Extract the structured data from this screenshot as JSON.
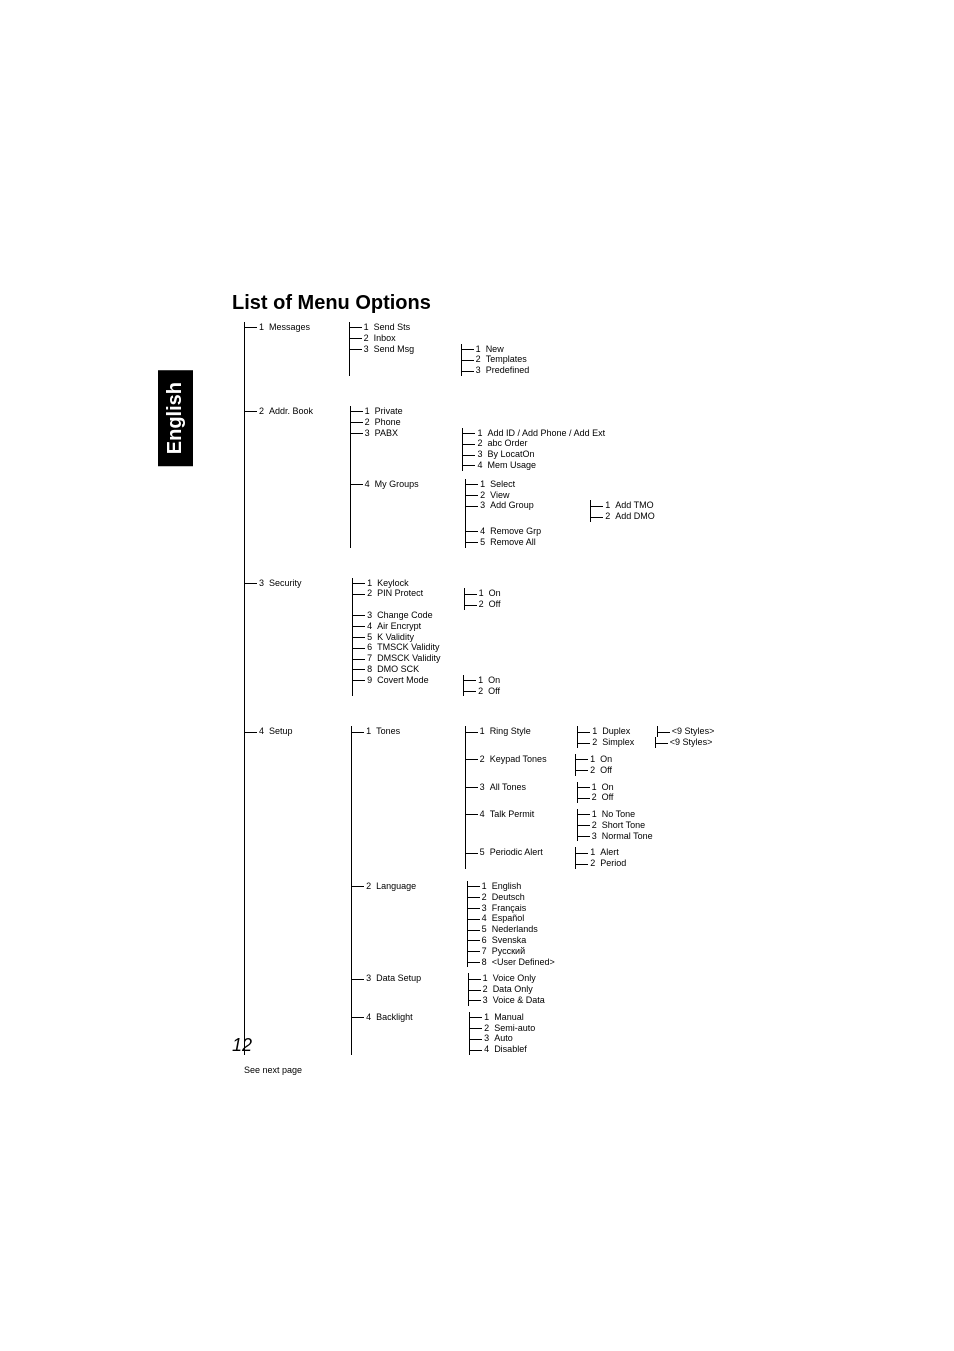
{
  "sideTab": "English",
  "title": "List of Menu Options",
  "pageNum": "12",
  "footnote": "See next page",
  "menu": {
    "messages": {
      "num": "1",
      "label": "Messages",
      "items": [
        {
          "num": "1",
          "label": "Send Sts"
        },
        {
          "num": "2",
          "label": "Inbox"
        },
        {
          "num": "3",
          "label": "Send Msg",
          "items": [
            {
              "num": "1",
              "label": "New"
            },
            {
              "num": "2",
              "label": "Templates"
            },
            {
              "num": "3",
              "label": "Predefined"
            }
          ]
        }
      ]
    },
    "addrbook": {
      "num": "2",
      "label": "Addr. Book",
      "items": [
        {
          "num": "1",
          "label": "Private"
        },
        {
          "num": "2",
          "label": "Phone"
        },
        {
          "num": "3",
          "label": "PABX",
          "items": [
            {
              "num": "1",
              "label": "Add ID / Add Phone / Add Ext"
            },
            {
              "num": "2",
              "label": "abc Order"
            },
            {
              "num": "3",
              "label": "By LocatOn"
            },
            {
              "num": "4",
              "label": "Mem Usage"
            }
          ]
        },
        {
          "num": "4",
          "label": "My Groups",
          "items": [
            {
              "num": "1",
              "label": "Select"
            },
            {
              "num": "2",
              "label": "View"
            },
            {
              "num": "3",
              "label": "Add Group",
              "items": [
                {
                  "num": "1",
                  "label": "Add TMO"
                },
                {
                  "num": "2",
                  "label": "Add DMO"
                }
              ]
            },
            {
              "num": "4",
              "label": "Remove Grp"
            },
            {
              "num": "5",
              "label": "Remove All"
            }
          ]
        }
      ]
    },
    "security": {
      "num": "3",
      "label": "Security",
      "items": [
        {
          "num": "1",
          "label": "Keylock"
        },
        {
          "num": "2",
          "label": "PIN Protect",
          "items": [
            {
              "num": "1",
              "label": "On"
            },
            {
              "num": "2",
              "label": "Off"
            }
          ]
        },
        {
          "num": "3",
          "label": "Change Code"
        },
        {
          "num": "4",
          "label": "Air Encrypt"
        },
        {
          "num": "5",
          "label": "K Validity"
        },
        {
          "num": "6",
          "label": "TMSCK Validity"
        },
        {
          "num": "7",
          "label": "DMSCK Validity"
        },
        {
          "num": "8",
          "label": "DMO SCK"
        },
        {
          "num": "9",
          "label": "Covert Mode",
          "items": [
            {
              "num": "1",
              "label": "On"
            },
            {
              "num": "2",
              "label": "Off"
            }
          ]
        }
      ]
    },
    "setup": {
      "num": "4",
      "label": "Setup",
      "items": [
        {
          "num": "1",
          "label": "Tones",
          "items": [
            {
              "num": "1",
              "label": "Ring Style",
              "items": [
                {
                  "num": "1",
                  "label": "Duplex",
                  "note": "<9 Styles>"
                },
                {
                  "num": "2",
                  "label": "Simplex",
                  "note": "<9 Styles>"
                }
              ]
            },
            {
              "num": "2",
              "label": "Keypad Tones",
              "items": [
                {
                  "num": "1",
                  "label": "On"
                },
                {
                  "num": "2",
                  "label": "Off"
                }
              ]
            },
            {
              "num": "3",
              "label": "All Tones",
              "items": [
                {
                  "num": "1",
                  "label": "On"
                },
                {
                  "num": "2",
                  "label": "Off"
                }
              ]
            },
            {
              "num": "4",
              "label": "Talk Permit",
              "items": [
                {
                  "num": "1",
                  "label": "No Tone"
                },
                {
                  "num": "2",
                  "label": "Short Tone"
                },
                {
                  "num": "3",
                  "label": "Normal Tone"
                }
              ]
            },
            {
              "num": "5",
              "label": "Periodic Alert",
              "items": [
                {
                  "num": "1",
                  "label": "Alert"
                },
                {
                  "num": "2",
                  "label": "Period"
                }
              ]
            }
          ]
        },
        {
          "num": "2",
          "label": "Language",
          "items": [
            {
              "num": "1",
              "label": "English"
            },
            {
              "num": "2",
              "label": "Deutsch"
            },
            {
              "num": "3",
              "label": "Français"
            },
            {
              "num": "4",
              "label": "Español"
            },
            {
              "num": "5",
              "label": "Nederlands"
            },
            {
              "num": "6",
              "label": "Svenska"
            },
            {
              "num": "7",
              "label": "Русский"
            },
            {
              "num": "8",
              "label": "<User Defined>"
            }
          ]
        },
        {
          "num": "3",
          "label": "Data Setup",
          "items": [
            {
              "num": "1",
              "label": "Voice Only"
            },
            {
              "num": "2",
              "label": "Data Only"
            },
            {
              "num": "3",
              "label": "Voice & Data"
            }
          ]
        },
        {
          "num": "4",
          "label": "Backlight",
          "items": [
            {
              "num": "1",
              "label": "Manual"
            },
            {
              "num": "2",
              "label": "Semi-auto"
            },
            {
              "num": "3",
              "label": "Auto"
            },
            {
              "num": "4",
              "label": "Disablef"
            }
          ]
        }
      ]
    }
  }
}
